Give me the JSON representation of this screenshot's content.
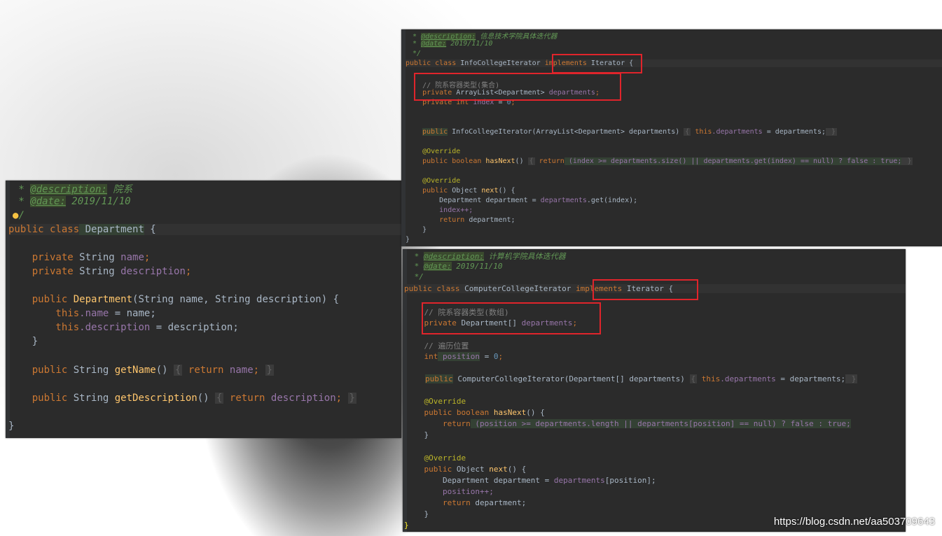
{
  "department": {
    "l1_star": " * ",
    "l1_tag": "@description:",
    "l1_text": " 院系",
    "l2_star": " * ",
    "l2_tag": "@date:",
    "l2_text": " 2019/11/10",
    "l3_text": "/",
    "l4_kw": "public class",
    "l4_name": " Department",
    "l4_brace": " {",
    "l5_kw": "    private",
    "l5_type": " String ",
    "l5_field": "name",
    "l5_end": ";",
    "l6_kw": "    private",
    "l6_type": " String ",
    "l6_field": "description",
    "l6_end": ";",
    "l7_kw": "    public",
    "l7_fn": " Department",
    "l7_rest": "(String name, String description) {",
    "l8_kw": "        this",
    "l8_field": ".name",
    "l8_rest": " = name;",
    "l9_kw": "        this",
    "l9_field": ".description",
    "l9_rest": " = description;",
    "l10": "    }",
    "l11_kw": "    public",
    "l11_type": " String ",
    "l11_fn": "getName",
    "l11_paren": "() ",
    "l11_fold_open": "{",
    "l11_ret": " return",
    "l11_field": " name",
    "l11_semi": ";",
    "l11_fold_close": "}",
    "l12_kw": "    public",
    "l12_type": " String ",
    "l12_fn": "getDescription",
    "l12_paren": "() ",
    "l12_fold_open": "{",
    "l12_ret": " return",
    "l12_field": " description",
    "l12_semi": ";",
    "l12_fold_close": "}",
    "l13": "}"
  },
  "info": {
    "l1_star": " * ",
    "l1_tag": "@description:",
    "l1_text": " 信息技术学院具体迭代器",
    "l2_star": " * ",
    "l2_tag": "@date:",
    "l2_text": " 2019/11/10",
    "l3": " */",
    "l4_kw": "public class",
    "l4_name": " InfoCollegeIterator ",
    "l4_impl": "implements",
    "l4_iface": " Iterator",
    "l4_brace": " {",
    "l5": "    // 院系容器类型(集合)",
    "l6_kw": "    private",
    "l6_type": " ArrayList<Department> ",
    "l6_field": "departments",
    "l6_end": ";",
    "l7_kw": "    private int",
    "l7_field": " index",
    "l7_eq": " = ",
    "l7_num": "0",
    "l7_end": ";",
    "l8_kw": "public",
    "l8_rest": " InfoCollegeIterator(ArrayList<Department> departments) ",
    "l8_fo": "{",
    "l8_this": " this",
    "l8_field": ".departments",
    "l8_tail": " = departments;",
    "l8_fc": " }",
    "l9": "    @Override",
    "l10_kw": "    public boolean",
    "l10_fn": " hasNext",
    "l10_paren": "() ",
    "l10_fo": "{",
    "l10_ret": " return",
    "l10_cond": " (index >= departments.size() || departments.get(index) == null) ? false : true;",
    "l10_fc": " }",
    "l11": "    @Override",
    "l12_kw": "    public",
    "l12_rest": " Object ",
    "l12_fn": "next",
    "l12_tail": "() {",
    "l13_type": "        Department department = ",
    "l13_field": "departments",
    "l13_tail": ".get(index);",
    "l14": "        index++;",
    "l15_kw": "        return",
    "l15_tail": " department;",
    "l16": "    }",
    "l17": "}"
  },
  "computer": {
    "l1_star": " * ",
    "l1_tag": "@description:",
    "l1_text": " 计算机学院具体迭代器",
    "l2_star": " * ",
    "l2_tag": "@date:",
    "l2_text": " 2019/11/10",
    "l3": " */",
    "l4_kw": "public class",
    "l4_name": " ComputerCollegeIterator ",
    "l4_impl": "implements",
    "l4_iface": " Iterator",
    "l4_brace": " {",
    "l5": "    // 院系容器类型(数组)",
    "l6_kw": "    private",
    "l6_type": " Department[] ",
    "l6_field": "departments",
    "l6_end": ";",
    "l7": "    // 遍历位置",
    "l8_kw": "    int",
    "l8_field": " position",
    "l8_eq": " = ",
    "l8_num": "0",
    "l8_end": ";",
    "l9_kw": "public",
    "l9_rest": " ComputerCollegeIterator(Department[] departments) ",
    "l9_fo": "{",
    "l9_this": " this",
    "l9_field": ".departments",
    "l9_tail": " = departments;",
    "l9_fc": " }",
    "l10": "    @Override",
    "l11_kw": "    public boolean",
    "l11_fn": " hasNext",
    "l11_tail": "() {",
    "l12_kw": "        return",
    "l12_cond": " (position >= departments.length || departments[position] == null) ? false : true;",
    "l13": "    }",
    "l14": "    @Override",
    "l15_kw": "    public",
    "l15_rest": " Object ",
    "l15_fn": "next",
    "l15_tail": "() {",
    "l16_type": "        Department department = ",
    "l16_field": "departments",
    "l16_tail": "[position];",
    "l17": "        position++;",
    "l18_kw": "        return",
    "l18_tail": " department;",
    "l19": "    }",
    "l20": "}"
  },
  "watermark": "https://blog.csdn.net/aa503709643",
  "colors": {
    "editor_bg": "#2b2b2b",
    "keyword": "#cc7832",
    "comment": "#629755",
    "field": "#9876aa",
    "function": "#ffc66d",
    "annotation": "#bbb529",
    "highlight_box": "#e0242b"
  },
  "icons": [
    "lightbulb-icon"
  ]
}
